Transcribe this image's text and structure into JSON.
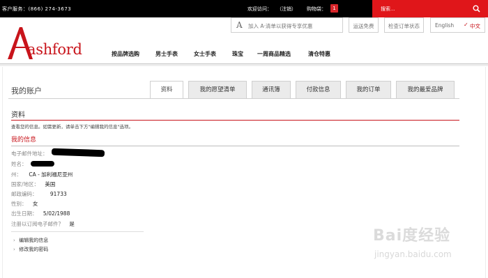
{
  "topbar": {
    "phone": "客户服务：(866) 274-3673",
    "welcome": "欢迎访问：",
    "logout": "（注销）",
    "cart_label": "购物袋：",
    "cart_count": "1",
    "search_placeholder": "搜索..."
  },
  "header": {
    "logo_text": "ashford",
    "join_mark": "A",
    "join_text": "加入 A·清单以获得专享优惠",
    "free_shipping": "运送免费",
    "order_status": "检查订单状态",
    "lang_en": "English",
    "lang_check": "✓",
    "lang_zh": "中文"
  },
  "nav": [
    {
      "label": "按品牌选购"
    },
    {
      "label": "男士手表"
    },
    {
      "label": "女士手表"
    },
    {
      "label": "珠宝"
    },
    {
      "label": "一周商品精选"
    },
    {
      "label": "清仓特惠"
    }
  ],
  "page": {
    "title": "我的账户",
    "tabs": [
      {
        "label": "资料",
        "active": true
      },
      {
        "label": "我的愿望清单",
        "active": false
      },
      {
        "label": "通讯簿",
        "active": false
      },
      {
        "label": "付款信息",
        "active": false
      },
      {
        "label": "我的订单",
        "active": false
      },
      {
        "label": "我的最爱品牌",
        "active": false
      }
    ],
    "section_title": "资料",
    "section_desc": "查看您的信息。如需更新，请单击下方\"编辑我的信息\"选项。",
    "info_title": "我的信息"
  },
  "fields": [
    {
      "label": "电子邮件地址：",
      "value": ""
    },
    {
      "label": "姓名：",
      "value": ""
    },
    {
      "label": "州：",
      "value": "CA - 加利福尼亚州"
    },
    {
      "label": "国家/地区：",
      "value": "美国"
    },
    {
      "label": "邮政编码：",
      "value": "91733"
    },
    {
      "label": "性别：",
      "value": "女"
    },
    {
      "label": "出生日期：",
      "value": "5/02/1988"
    },
    {
      "label": "注册以订阅电子邮件？",
      "value": "是"
    }
  ],
  "links": [
    {
      "label": "编辑我的信息"
    },
    {
      "label": "修改我的密码"
    }
  ],
  "watermark": {
    "main": "Bai度经验",
    "sub": "jingyan.baidu.com"
  },
  "colors": {
    "brand_red": "#c8141b",
    "search_red": "#e0161a",
    "topbar_bg": "#000000"
  }
}
